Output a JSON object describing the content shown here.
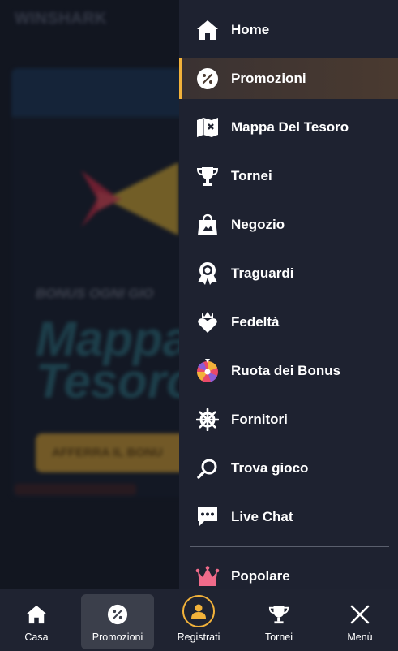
{
  "background": {
    "logo_text": "WINSHARK",
    "kicker": "BONUS OGNI GIO",
    "title": "Mappa\nTesoro",
    "cta": "AFFERRA IL BONU"
  },
  "menu": {
    "items": [
      {
        "label": "Home",
        "icon": "home-icon"
      },
      {
        "label": "Promozioni",
        "icon": "percent-icon",
        "active": true
      },
      {
        "label": "Mappa Del Tesoro",
        "icon": "map-icon"
      },
      {
        "label": "Tornei",
        "icon": "trophy-icon"
      },
      {
        "label": "Negozio",
        "icon": "shopping-bag-icon"
      },
      {
        "label": "Traguardi",
        "icon": "award-icon"
      },
      {
        "label": "Fedeltà",
        "icon": "crown-heart-icon"
      },
      {
        "label": "Ruota dei Bonus",
        "icon": "wheel-icon"
      },
      {
        "label": "Fornitori",
        "icon": "ship-wheel-icon"
      },
      {
        "label": "Trova gioco",
        "icon": "search-icon"
      },
      {
        "label": "Live Chat",
        "icon": "chat-icon"
      },
      {
        "label": "Popolare",
        "icon": "crown-icon"
      }
    ],
    "accent_color": "#f2b23a"
  },
  "bottom_nav": {
    "items": [
      {
        "label": "Casa",
        "icon": "home-icon"
      },
      {
        "label": "Promozioni",
        "icon": "percent-icon",
        "active": true
      },
      {
        "label": "Registrati",
        "icon": "user-icon"
      },
      {
        "label": "Tornei",
        "icon": "trophy-icon"
      },
      {
        "label": "Menù",
        "icon": "close-icon"
      }
    ]
  }
}
